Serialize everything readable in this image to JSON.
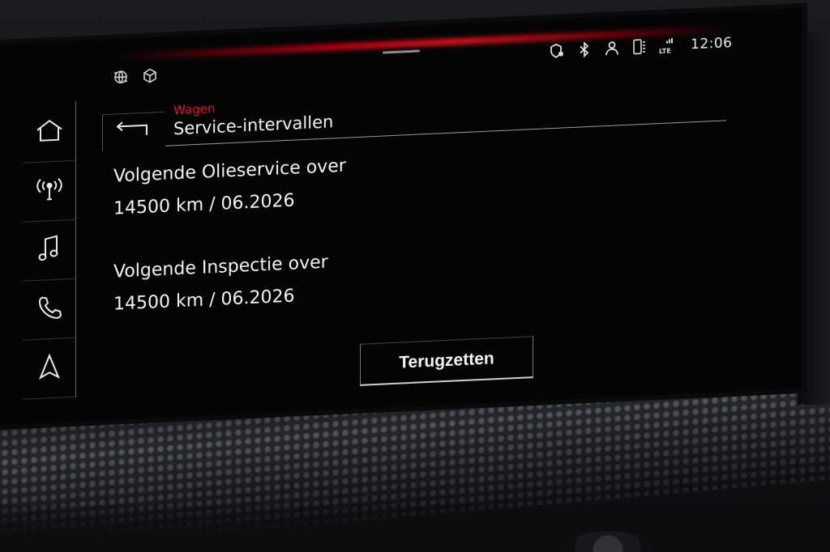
{
  "status_bar": {
    "time": "12:06",
    "left_icons": [
      "sync-globe-icon",
      "cube-icon"
    ],
    "right_icons": [
      "location-shield-icon",
      "bluetooth-icon",
      "profile-icon",
      "phone-battery-icon",
      "lte-signal-icon"
    ]
  },
  "sidebar": {
    "items": [
      {
        "name": "home",
        "icon": "home-icon"
      },
      {
        "name": "radio",
        "icon": "radio-antenna-icon"
      },
      {
        "name": "media",
        "icon": "music-note-icon"
      },
      {
        "name": "phone",
        "icon": "phone-icon"
      },
      {
        "name": "navigation",
        "icon": "navigation-arrow-icon"
      }
    ]
  },
  "header": {
    "breadcrumb": "Wagen",
    "title": "Service-intervallen"
  },
  "service": {
    "oil_label": "Volgende Olieservice over",
    "oil_value": "14500 km / 06.2026",
    "inspection_label": "Volgende Inspectie over",
    "inspection_value": "14500 km / 06.2026"
  },
  "actions": {
    "reset_label": "Terugzetten"
  },
  "colors": {
    "accent_red": "#e0102a",
    "text": "#f0f0f0",
    "background": "#040404"
  }
}
